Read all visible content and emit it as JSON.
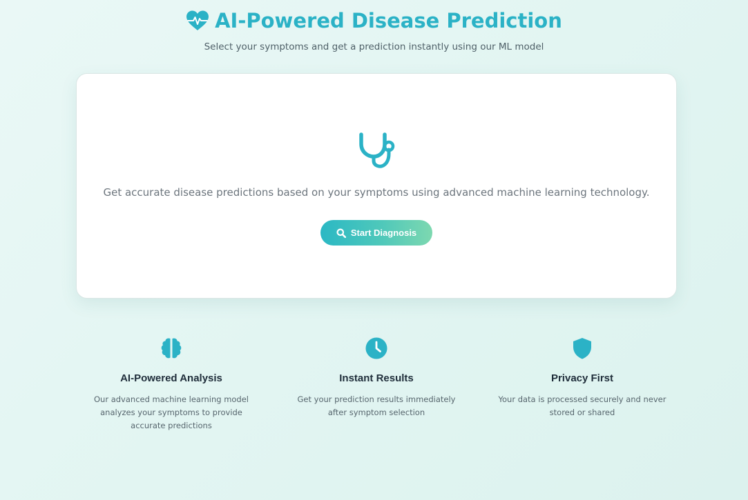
{
  "header": {
    "title": "AI-Powered Disease Prediction",
    "subtitle": "Select your symptoms and get a prediction instantly using our ML model",
    "icon": "heart-pulse-icon"
  },
  "hero_card": {
    "icon": "stethoscope-icon",
    "description": "Get accurate disease predictions based on your symptoms using advanced machine learning technology.",
    "button_label": "Start Diagnosis",
    "button_icon": "search-icon"
  },
  "features": [
    {
      "icon": "brain-icon",
      "title": "AI-Powered Analysis",
      "description": "Our advanced machine learning model analyzes your symptoms to provide accurate predictions"
    },
    {
      "icon": "clock-icon",
      "title": "Instant Results",
      "description": "Get your prediction results immediately after symptom selection"
    },
    {
      "icon": "shield-icon",
      "title": "Privacy First",
      "description": "Your data is processed securely and never stored or shared"
    }
  ],
  "colors": {
    "accent": "#2bb2c6",
    "button_gradient_start": "#2bb8c4",
    "button_gradient_end": "#7dd8b0",
    "heading_dark": "#1f2d3a",
    "muted_text": "#6c757d"
  }
}
